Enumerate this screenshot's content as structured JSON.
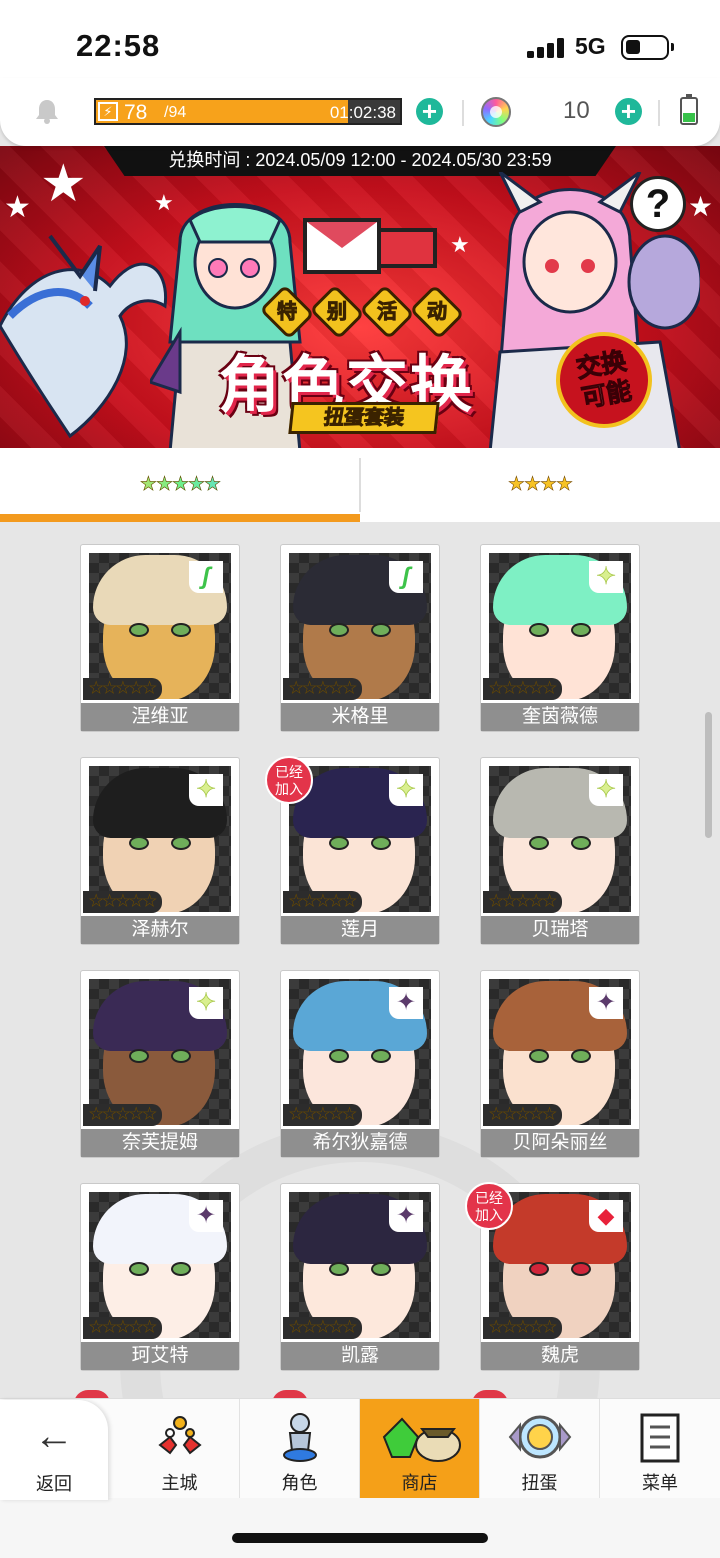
{
  "status": {
    "time": "22:58",
    "network": "5G"
  },
  "resources": {
    "stamina_current": "78",
    "stamina_max": "/94",
    "stamina_fraction": 0.83,
    "stamina_timer": "01:02:38",
    "gem_count": "10"
  },
  "banner": {
    "date_range": "兑换时间 : 2024.05/09 12:00 - 2024.05/30 23:59",
    "event_tag": [
      "特",
      "别",
      "活",
      "动"
    ],
    "title": "角色交换",
    "subtitle": "扭蛋套装",
    "stamp_line1": "交换",
    "stamp_line2": "可能",
    "help_label": "?"
  },
  "tabs": [
    {
      "stars": "★★★★★",
      "active": true
    },
    {
      "stars": "★★★★",
      "active": false
    }
  ],
  "characters": [
    {
      "name": "涅维亚",
      "stars": "★★★★★",
      "element": "leaf",
      "glyph": "ʃ",
      "joined": false,
      "hair": "#e9d9b8",
      "skin": "#e6b35a"
    },
    {
      "name": "米格里",
      "stars": "★★★★★",
      "element": "leaf",
      "glyph": "ʃ",
      "joined": false,
      "hair": "#2b2b35",
      "skin": "#b07a4a"
    },
    {
      "name": "奎茵薇德",
      "stars": "★★★★★",
      "element": "light",
      "glyph": "✦",
      "joined": false,
      "hair": "#7ef0c4",
      "skin": "#ffe3d6"
    },
    {
      "name": "泽赫尔",
      "stars": "★★★★★",
      "element": "light",
      "glyph": "✦",
      "joined": false,
      "hair": "#1e1e1e",
      "skin": "#f0d2b4"
    },
    {
      "name": "莲月",
      "stars": "★★★★★",
      "element": "light",
      "glyph": "✦",
      "joined": true,
      "hair": "#2a2450",
      "skin": "#fbe4d6"
    },
    {
      "name": "贝瑞塔",
      "stars": "★★★★★",
      "element": "light",
      "glyph": "✦",
      "joined": false,
      "hair": "#b8b8b0",
      "skin": "#fbe6da"
    },
    {
      "name": "奈芙提姆",
      "stars": "★★★★★",
      "element": "light",
      "glyph": "✦",
      "joined": false,
      "hair": "#3a2a55",
      "skin": "#8a5a3c"
    },
    {
      "name": "希尔狄嘉德",
      "stars": "★★★★★",
      "element": "dark",
      "glyph": "✦",
      "joined": false,
      "hair": "#5aa7d6",
      "skin": "#fce6dc"
    },
    {
      "name": "贝阿朵丽丝",
      "stars": "★★★★★",
      "element": "dark",
      "glyph": "✦",
      "joined": false,
      "hair": "#a8623a",
      "skin": "#fbe1cf"
    },
    {
      "name": "珂艾特",
      "stars": "★★★★★",
      "element": "dark",
      "glyph": "✦",
      "joined": false,
      "hair": "#f2f4fb",
      "skin": "#fdeee6"
    },
    {
      "name": "凯露",
      "stars": "★★★★★",
      "element": "dark",
      "glyph": "✦",
      "joined": false,
      "hair": "#2c2640",
      "skin": "#fde8dc"
    },
    {
      "name": "魏虎",
      "stars": "★★★★★",
      "element": "fire",
      "glyph": "◆",
      "joined": true,
      "hair": "#c43a2a",
      "skin": "#f0d2c0"
    }
  ],
  "joined_label_line1": "已经",
  "joined_label_line2": "加入",
  "nav": {
    "back": "返回",
    "items": [
      {
        "label": "主城",
        "active": false
      },
      {
        "label": "角色",
        "active": false
      },
      {
        "label": "商店",
        "active": true
      },
      {
        "label": "扭蛋",
        "active": false
      },
      {
        "label": "菜单",
        "active": false
      }
    ]
  },
  "colors": {
    "accent": "#f39a1e",
    "plus": "#1fb89a",
    "banner_red": "#c80f1c",
    "joined_badge": "#e3344a"
  }
}
